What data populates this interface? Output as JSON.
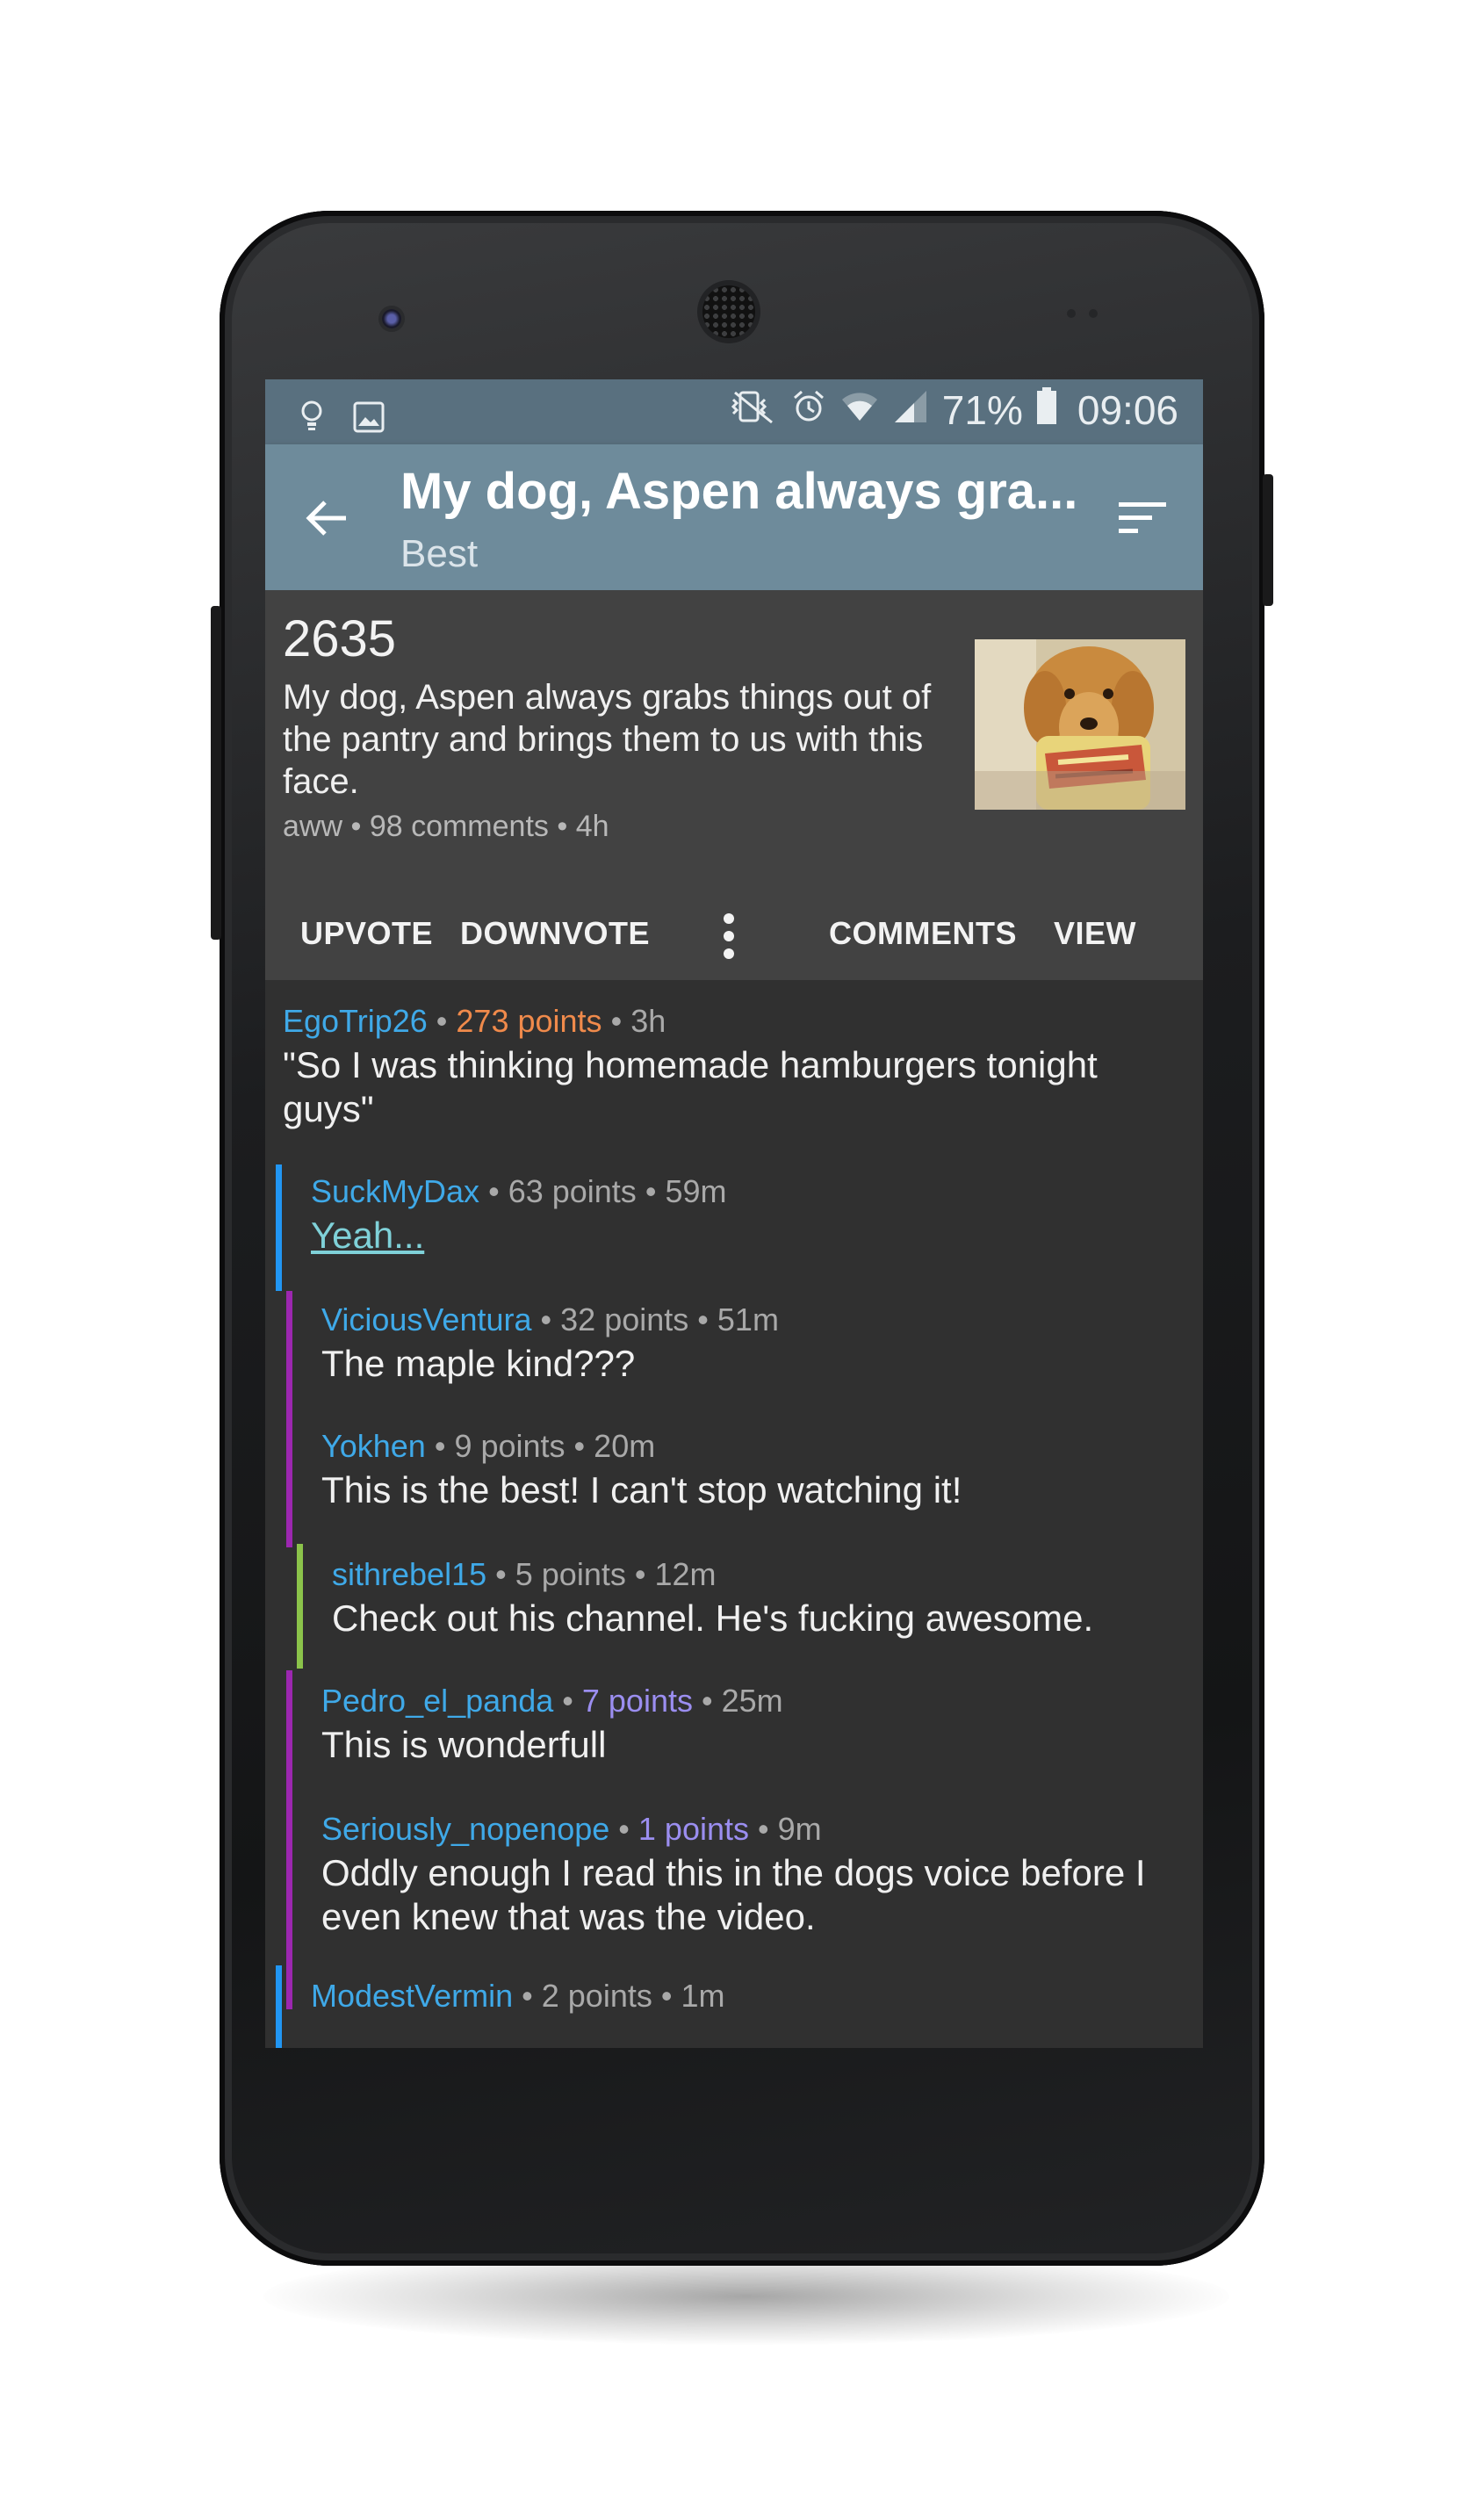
{
  "status_bar": {
    "left_icons": [
      "lightbulb-icon",
      "image-icon"
    ],
    "right_icons": [
      "vibrate-icon",
      "alarm-icon",
      "wifi-icon",
      "signal-icon"
    ],
    "battery": "71%",
    "time": "09:06"
  },
  "toolbar": {
    "title": "My dog, Aspen always gra...",
    "subtitle": "Best"
  },
  "post": {
    "score": "2635",
    "title": "My dog, Aspen always grabs things out of the pantry and brings them to us with this face.",
    "meta": "aww • 98 comments • 4h",
    "actions": {
      "upvote": "UPVOTE",
      "downvote": "DOWNVOTE",
      "comments": "COMMENTS",
      "view": "VIEW"
    }
  },
  "comments": [
    {
      "author": "EgoTrip26",
      "points": "273 points",
      "time": "3h",
      "body": "\"So I was thinking homemade hamburgers tonight guys\"",
      "points_color": "#f08a4b"
    },
    {
      "author": "SuckMyDax",
      "points": "63 points",
      "time": "59m",
      "body": "Yeah...",
      "bar_color": "#2196f3"
    },
    {
      "author": "ViciousVentura",
      "points": "32 points",
      "time": "51m",
      "body": "The maple kind???",
      "bar_color": "#9c27b0"
    },
    {
      "author": "Yokhen",
      "points": "9 points",
      "time": "20m",
      "body": "This is the best! I can't stop watching it!",
      "bar_color": "#9c27b0"
    },
    {
      "author": "sithrebel15",
      "points": "5 points",
      "time": "12m",
      "body": "Check out his channel. He's fucking awesome.",
      "bar_color": "#8bc34a"
    },
    {
      "author": "Pedro_el_panda",
      "points": "7 points",
      "time": "25m",
      "body": "This is wonderfull",
      "bar_color": "#9c27b0",
      "points_color": "#9b8ef0"
    },
    {
      "author": "Seriously_nopenope",
      "points": "1 points",
      "time": "9m",
      "body": "Oddly enough I read this in the dogs voice before I even knew that was the video.",
      "bar_color": "#9c27b0",
      "points_color": "#9b8ef0"
    },
    {
      "author": "ModestVermin",
      "points": "2 points",
      "time": "1m",
      "body": "",
      "bar_color": "#2196f3"
    }
  ],
  "meta_separator": "•"
}
